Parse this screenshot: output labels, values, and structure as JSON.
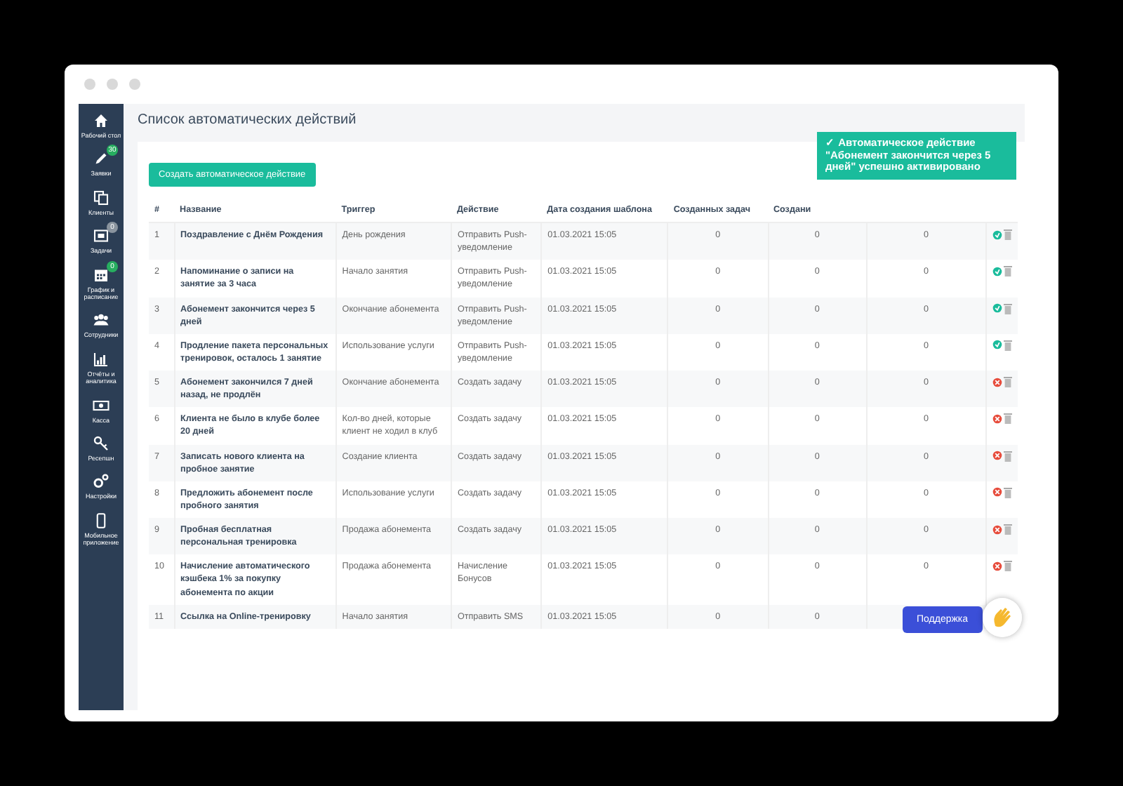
{
  "sidebar": {
    "items": [
      {
        "label": "Рабочий стол",
        "selected": false
      },
      {
        "label": "Заявки",
        "badge": "30",
        "color": "#27ae60",
        "selected": false
      },
      {
        "label": "Клиенты",
        "selected": false
      },
      {
        "label": "Задачи",
        "badge": "0",
        "color": "#8a949e",
        "selected": false
      },
      {
        "label": "График и расписание",
        "badge": "0",
        "color": "#27ae60",
        "selected": false
      },
      {
        "label": "Сотрудники",
        "selected": false
      },
      {
        "label": "Отчёты и аналитика",
        "selected": false
      },
      {
        "label": "Касса",
        "selected": false
      },
      {
        "label": "Ресепшн",
        "selected": false
      },
      {
        "label": "Настройки",
        "selected": false
      },
      {
        "label": "Мобильное приложение",
        "selected": false
      }
    ]
  },
  "page_title": "Список автоматических действий",
  "create_button": "Создать автоматическое действие",
  "table": {
    "columns": [
      "#",
      "Название",
      "Триггер",
      "Действие",
      "Дата создания шаблона",
      "Созданных задач",
      "Создани"
    ],
    "rows": [
      {
        "n": "1",
        "name": "Поздравление с Днём Рождения",
        "trigger": "День рождения",
        "action": "Отправить Push-уведомление",
        "date": "01.03.2021 15:05",
        "counts": [
          "0",
          "0",
          "0"
        ],
        "active": true
      },
      {
        "n": "2",
        "name": "Напоминание о записи на занятие за 3 часа",
        "trigger": "Начало занятия",
        "action": "Отправить Push-уведомление",
        "date": "01.03.2021 15:05",
        "counts": [
          "0",
          "0",
          "0"
        ],
        "active": true
      },
      {
        "n": "3",
        "name": "Абонемент закончится через 5 дней",
        "trigger": "Окончание абонемента",
        "action": "Отправить Push-уведомление",
        "date": "01.03.2021 15:05",
        "counts": [
          "0",
          "0",
          "0"
        ],
        "active": true
      },
      {
        "n": "4",
        "name": "Продление пакета персональных тренировок, осталось 1 занятие",
        "trigger": "Использование услуги",
        "action": "Отправить Push-уведомление",
        "date": "01.03.2021 15:05",
        "counts": [
          "0",
          "0",
          "0"
        ],
        "active": true
      },
      {
        "n": "5",
        "name": "Абонемент закончился 7 дней назад, не продлён",
        "trigger": "Окончание абонемента",
        "action": "Создать задачу",
        "date": "01.03.2021 15:05",
        "counts": [
          "0",
          "0",
          "0"
        ],
        "active": false
      },
      {
        "n": "6",
        "name": "Клиента не было в клубе более 20 дней",
        "trigger": "Кол-во дней, которые клиент не ходил в клуб",
        "action": "Создать задачу",
        "date": "01.03.2021 15:05",
        "counts": [
          "0",
          "0",
          "0"
        ],
        "active": false
      },
      {
        "n": "7",
        "name": "Записать нового клиента на пробное занятие",
        "trigger": "Создание клиента",
        "action": "Создать задачу",
        "date": "01.03.2021 15:05",
        "counts": [
          "0",
          "0",
          "0"
        ],
        "active": false
      },
      {
        "n": "8",
        "name": "Предложить абонемент после пробного занятия",
        "trigger": "Использование услуги",
        "action": "Создать задачу",
        "date": "01.03.2021 15:05",
        "counts": [
          "0",
          "0",
          "0"
        ],
        "active": false
      },
      {
        "n": "9",
        "name": "Пробная бесплатная персональная тренировка",
        "trigger": "Продажа абонемента",
        "action": "Создать задачу",
        "date": "01.03.2021 15:05",
        "counts": [
          "0",
          "0",
          "0"
        ],
        "active": false
      },
      {
        "n": "10",
        "name": "Начисление автоматического кэшбека 1% за покупку абонемента по акции",
        "trigger": "Продажа абонемента",
        "action": "Начисление Бонусов",
        "date": "01.03.2021 15:05",
        "counts": [
          "0",
          "0",
          "0"
        ],
        "active": false
      },
      {
        "n": "11",
        "name": "Ссылка на Online-тренировку",
        "trigger": "Начало занятия",
        "action": "Отправить SMS",
        "date": "01.03.2021 15:05",
        "counts": [
          "0",
          "0"
        ]
      }
    ]
  },
  "toast": {
    "mark": "✓",
    "text": "Автоматическое действие \"Абонемент закончится через 5 дней\" успешно активировано"
  },
  "support_button": "Поддержка"
}
